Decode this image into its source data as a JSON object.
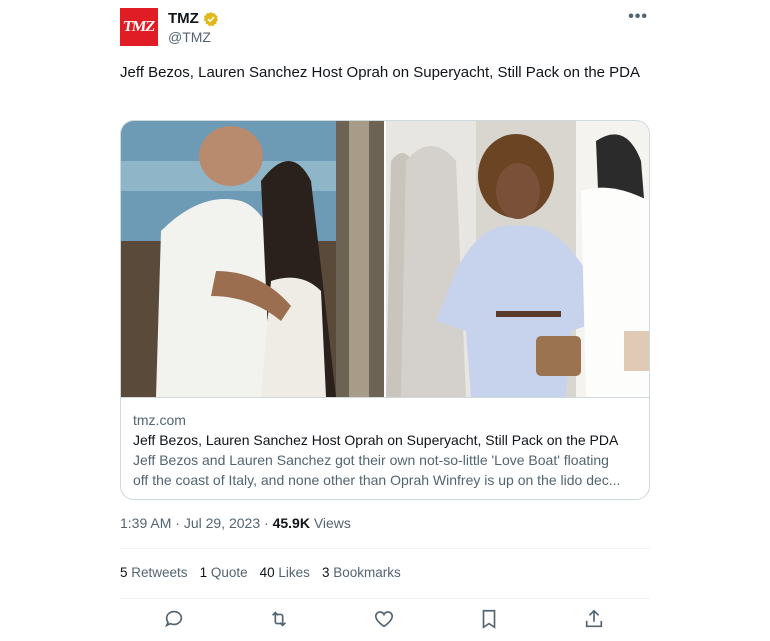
{
  "author": {
    "name": "TMZ",
    "handle": "@TMZ",
    "avatar_text": "TMZ"
  },
  "tweet_text": "Jeff Bezos, Lauren Sanchez Host Oprah on Superyacht, Still Pack on the PDA",
  "card": {
    "domain": "tmz.com",
    "title": "Jeff Bezos, Lauren Sanchez Host Oprah on Superyacht, Still Pack on the PDA",
    "description_line1": "Jeff Bezos and Lauren Sanchez got their own not-so-little 'Love Boat' floating",
    "description_line2": "off the coast of Italy, and none other than Oprah Winfrey is up on the lido dec..."
  },
  "meta": {
    "time": "1:39 AM",
    "sep1": " · ",
    "date": "Jul 29, 2023",
    "sep2": " · ",
    "views_count": "45.9K",
    "views_label": " Views"
  },
  "stats": [
    {
      "count": "5",
      "label": "Retweets"
    },
    {
      "count": "1",
      "label": "Quote"
    },
    {
      "count": "40",
      "label": "Likes"
    },
    {
      "count": "3",
      "label": "Bookmarks"
    }
  ],
  "colors": {
    "brand": "#e01c24",
    "text": "#0f1419",
    "muted": "#536471",
    "border": "#cfd9de",
    "verified": "#e2b719"
  },
  "icons": [
    "more-icon",
    "verified-badge-icon",
    "reply-icon",
    "retweet-icon",
    "like-icon",
    "bookmark-icon",
    "share-icon"
  ]
}
